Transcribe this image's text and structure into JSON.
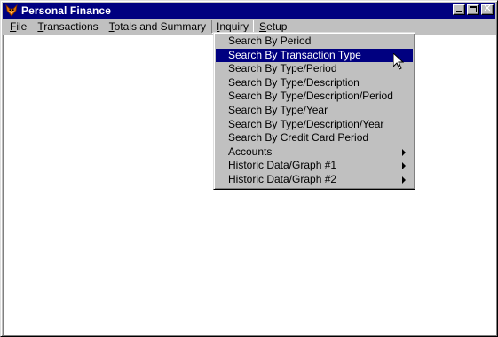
{
  "window": {
    "title": "Personal Finance",
    "icon": "fox-head-icon"
  },
  "titlebar_buttons": [
    {
      "name": "minimize",
      "icon": "minimize-icon"
    },
    {
      "name": "maximize",
      "icon": "maximize-icon"
    },
    {
      "name": "close",
      "icon": "close-icon"
    }
  ],
  "menubar": {
    "items": [
      {
        "id": "file",
        "mnemonic": "F",
        "rest": "ile"
      },
      {
        "id": "transactions",
        "mnemonic": "T",
        "rest": "ransactions"
      },
      {
        "id": "totals",
        "mnemonic": "T",
        "rest": "otals and Summary"
      },
      {
        "id": "inquiry",
        "mnemonic": "I",
        "rest": "nquiry",
        "open": true
      },
      {
        "id": "setup",
        "mnemonic": "S",
        "rest": "etup"
      }
    ]
  },
  "inquiry_menu": {
    "items": [
      {
        "label": "Search By Period"
      },
      {
        "label": "Search By Transaction Type",
        "highlighted": true
      },
      {
        "label": "Search By Type/Period"
      },
      {
        "label": "Search By Type/Description"
      },
      {
        "label": "Search By Type/Description/Period"
      },
      {
        "label": "Search By Type/Year"
      },
      {
        "label": "Search By Type/Description/Year"
      },
      {
        "label": "Search By Credit Card Period"
      },
      {
        "label": "Accounts",
        "submenu": true
      },
      {
        "label": "Historic Data/Graph #1",
        "submenu": true
      },
      {
        "label": "Historic Data/Graph #2",
        "submenu": true
      }
    ]
  },
  "colors": {
    "titlebar": "#000080",
    "face": "#c0c0c0",
    "highlight": "#000080",
    "client": "#ffffff"
  }
}
